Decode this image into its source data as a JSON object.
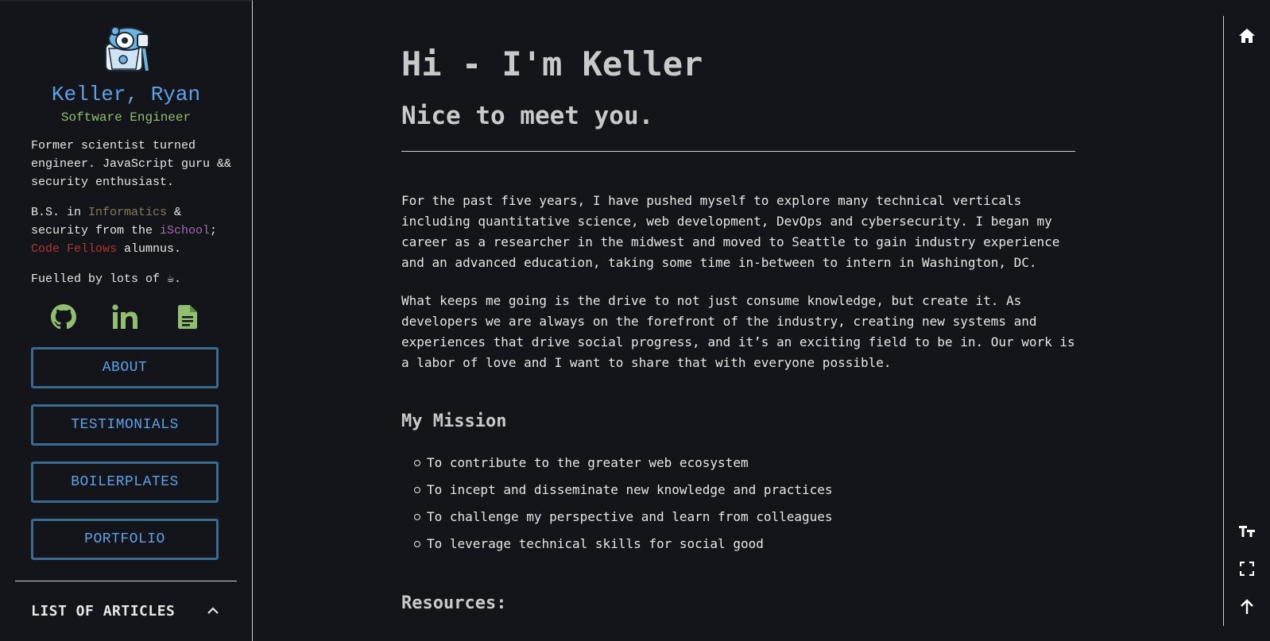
{
  "profile": {
    "name": "Keller, Ryan",
    "title": "Software Engineer",
    "bio": {
      "line1": "Former scientist turned engineer. JavaScript guru && security enthusiast.",
      "edu_prefix": "B.S. in ",
      "informatics": "Informatics",
      "edu_mid": " & security from the ",
      "ischool": "iSchool",
      "edu_sep": ";",
      "codefellows": "Code Fellows",
      "edu_suffix": " alumnus.",
      "fuel": "Fuelled by lots of ☕."
    }
  },
  "socials": {
    "github_icon": "github-icon",
    "linkedin_icon": "linkedin-icon",
    "resume_icon": "document-icon"
  },
  "nav": {
    "about": "ABOUT",
    "testimonials": "TESTIMONIALS",
    "boilerplates": "BOILERPLATES",
    "portfolio": "PORTFOLIO"
  },
  "articles": {
    "label": "LIST OF ARTICLES",
    "icon": "chevron-up-icon"
  },
  "main": {
    "title": "Hi - I'm Keller",
    "subtitle": "Nice to meet you.",
    "para1": "For the past five years, I have pushed myself to explore many technical verticals including quantitative science, web development, DevOps and cybersecurity. I began my career as a researcher in the midwest and moved to Seattle to gain industry experience and an advanced education, taking some time in-between to intern in Washington, DC.",
    "para2": "What keeps me going is the drive to not just consume knowledge, but create it. As developers we are always on the forefront of the industry, creating new systems and experiences that drive social progress, and it’s an exciting field to be in. Our work is a labor of love and I want to share that with everyone possible.",
    "mission_heading": "My Mission",
    "mission_items": [
      "To contribute to the greater web ecosystem",
      "To incept and disseminate new knowledge and practices",
      "To challenge my perspective and learn from colleagues",
      "To leverage technical skills for social good"
    ],
    "resources_heading": "Resources:"
  },
  "rail": {
    "home_icon": "home-icon",
    "font_icon": "font-size-icon",
    "fullscreen_icon": "fullscreen-icon",
    "up_icon": "arrow-up-icon"
  },
  "colors": {
    "background": "#13151a",
    "accent_blue": "#5fa0e6",
    "accent_green": "#8fbf6f",
    "button_border": "#3a6a91"
  }
}
